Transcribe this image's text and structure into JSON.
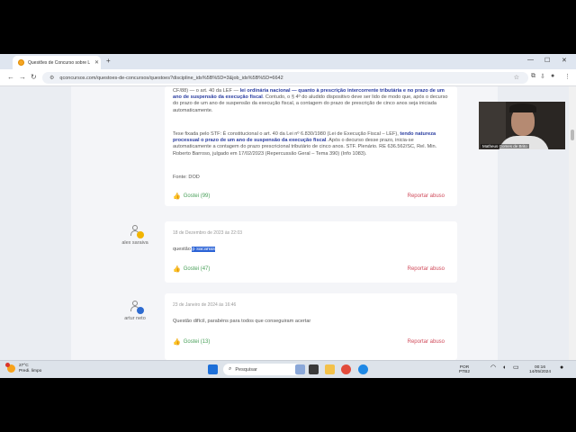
{
  "browser": {
    "tab_title": "Questões de Concurso sobre L",
    "tab_close": "✕",
    "new_tab": "+",
    "url": "qconcursos.com/questoes-de-concursos/questoes?discipline_ids%5B%5D=3&job_ids%5B%5D=6642"
  },
  "comments": [
    {
      "text_a": "CF/88) — o art. 40 da LEF — ",
      "text_a_hl": "lei ordinária nacional — quanto à prescrição intercorrente tributária e no prazo de um ano de suspensão da execução fiscal",
      "text_a_end": ". Contudo, o § 4º do aludido dispositivo deve ser lido de modo que, após o decurso do prazo de um ano de suspensão da execução fiscal, a contagem do prazo de prescrição de cinco anos seja iniciada automaticamente.",
      "text_b": "Tese fixada pelo STF: É constitucional o art. 40 da Lei nº 6.830/1980 (Lei de Execução Fiscal – LEF), ",
      "text_b_hl": "tendo natureza processual o prazo de um ano de suspensão da execução fiscal",
      "text_b_end": ". Após o decurso desse prazo, inicia-se automaticamente a contagem do prazo prescricional tributário de cinco anos. STF. Plenário. RE 636.562/SC, Rel. Min. Roberto Barroso, julgado em 17/02/2023 (Repercussão Geral – Tema 390) (Info 1083).",
      "source": "Fonte: DOD",
      "likes": "Gostei (99)",
      "report": "Reportar abuso"
    },
    {
      "author": "alex saraiva",
      "date": "18 de Dezembro de 2023 às 22:03",
      "text_pre": "questão ",
      "text_sel": "p sacanas",
      "likes": "Gostei (47)",
      "report": "Reportar abuso"
    },
    {
      "author": "artur neto",
      "date": "23 de Janeiro de 2024 às 16:46",
      "text": "Questão difícil, parabéns para todos que conseguiram acertar",
      "likes": "Gostei (13)",
      "report": "Reportar abuso"
    }
  ],
  "webcam": {
    "caption": "Matheus Gomes de Brito"
  },
  "taskbar": {
    "temp": "27°C",
    "weather": "Predi. limpo",
    "search": "Pesquisar",
    "lang": "POR",
    "layout": "PTB2",
    "time": "00:16",
    "date": "14/05/2024"
  },
  "colors": {
    "link_blue": "#2a3da0",
    "like_green": "#4aa05a",
    "report_red": "#d04a5a",
    "selection": "#2a62d6"
  },
  "icons": [
    "tab-favicon",
    "back-icon",
    "forward-icon",
    "reload-icon",
    "lock-icon",
    "star-icon",
    "extensions-icon",
    "download-icon",
    "profile-icon",
    "menu-icon",
    "thumbs-up-icon",
    "avatar-icon",
    "windows-start-icon",
    "search-icon",
    "wifi-icon",
    "volume-icon",
    "battery-icon"
  ]
}
